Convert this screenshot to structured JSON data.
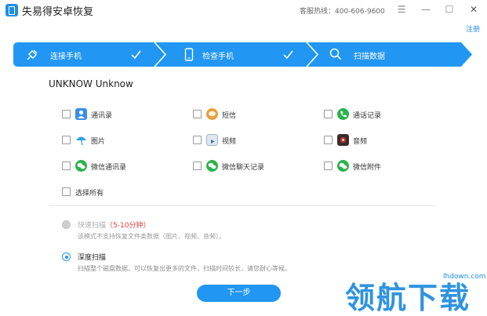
{
  "app": {
    "title": "失易得安卓恢复",
    "hotline": "客服热线：400-606-9600",
    "register": "注册"
  },
  "window_controls": {
    "menu_glyph": "☰",
    "minimize_glyph": "—",
    "maximize_glyph": "☐",
    "close_glyph": "✕"
  },
  "steps": [
    {
      "label": "连接手机",
      "icon": "usb-plug-icon",
      "done": true
    },
    {
      "label": "检查手机",
      "icon": "phone-icon",
      "done": true
    },
    {
      "label": "扫描数据",
      "icon": "search-icon",
      "done": false
    }
  ],
  "device": {
    "name": "UNKNOW Unknow"
  },
  "options": [
    {
      "label": "通讯录",
      "icon": "contacts-icon",
      "color": "#3a8ee6",
      "checked": false
    },
    {
      "label": "短信",
      "icon": "sms-icon",
      "color": "#e6a23c",
      "checked": false
    },
    {
      "label": "通话记录",
      "icon": "phone-call-icon",
      "color": "#2bb24c",
      "checked": false
    },
    {
      "label": "图片",
      "icon": "picture-icon",
      "color": "#2f9fe0",
      "checked": false
    },
    {
      "label": "视频",
      "icon": "video-icon",
      "color": "#5b7fa6",
      "checked": false
    },
    {
      "label": "音频",
      "icon": "audio-icon",
      "color": "#c0392b",
      "checked": false
    },
    {
      "label": "微信通讯录",
      "icon": "wechat-icon",
      "color": "#2bb24c",
      "checked": false
    },
    {
      "label": "微信聊天记录",
      "icon": "wechat-icon",
      "color": "#2bb24c",
      "checked": false
    },
    {
      "label": "微信附件",
      "icon": "wechat-icon",
      "color": "#2bb24c",
      "checked": false
    }
  ],
  "select_all": {
    "label": "选择所有",
    "checked": false
  },
  "scan_modes": {
    "quick": {
      "title": "快速扫描",
      "duration": "（5-10分钟）",
      "desc": "该模式不支持恢复文件类数据（图片、视频、音频）。",
      "selected": false,
      "disabled": true
    },
    "deep": {
      "title": "深度扫描",
      "desc": "扫描整个磁盘数据，可以恢复出更多的文件，扫描时间较长，请您耐心等候。",
      "selected": true,
      "disabled": false
    }
  },
  "next_button": "下一步",
  "watermark": {
    "text": "领航下载",
    "url": "lhdown.com"
  },
  "colors": {
    "accent": "#2196f3",
    "step_bar": "#2196f3",
    "duration": "#e53935"
  }
}
